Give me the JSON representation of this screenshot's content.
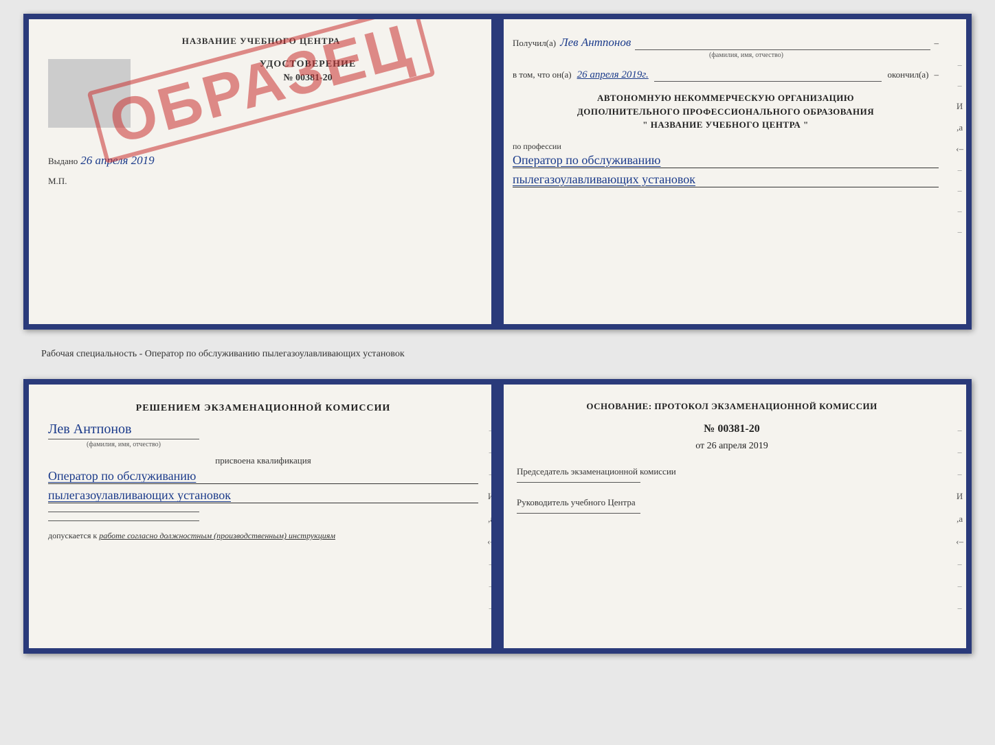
{
  "top_spread": {
    "left_page": {
      "title": "НАЗВАНИЕ УЧЕБНОГО ЦЕНТРА",
      "cert_type": "УДОСТОВЕРЕНИЕ",
      "cert_number": "№ 00381-20",
      "issued_label": "Выдано",
      "issued_date": "26 апреля 2019",
      "mp_label": "М.П.",
      "watermark": "ОБРАЗЕЦ"
    },
    "right_page": {
      "recipient_label": "Получил(а)",
      "recipient_name": "Лев Антпонов",
      "fio_sublabel": "(фамилия, имя, отчество)",
      "in_that_label": "в том, что он(а)",
      "date_value": "26 апреля 2019г.",
      "finished_label": "окончил(а)",
      "org_line1": "АВТОНОМНУЮ НЕКОММЕРЧЕСКУЮ ОРГАНИЗАЦИЮ",
      "org_line2": "ДОПОЛНИТЕЛЬНОГО ПРОФЕССИОНАЛЬНОГО ОБРАЗОВАНИЯ",
      "org_line3": "\" НАЗВАНИЕ УЧЕБНОГО ЦЕНТРА \"",
      "profession_label": "по профессии",
      "profession_line1": "Оператор по обслуживанию",
      "profession_line2": "пылегазоулавливающих установок"
    }
  },
  "middle_text": "Рабочая специальность - Оператор по обслуживанию пылегазоулавливающих установок",
  "bottom_spread": {
    "left_page": {
      "decision_title": "Решением экзаменационной комиссии",
      "name": "Лев Антпонов",
      "fio_sublabel": "(фамилия, имя, отчество)",
      "assigned_label": "присвоена квалификация",
      "qualification_line1": "Оператор по обслуживанию",
      "qualification_line2": "пылегазоулавливающих установок",
      "allowed_label": "допускается к",
      "allowed_value": "работе согласно должностным (производственным) инструкциям"
    },
    "right_page": {
      "basis_label": "Основание: протокол экзаменационной комиссии",
      "protocol_number": "№ 00381-20",
      "date_prefix": "от",
      "date_value": "26 апреля 2019",
      "chairman_label": "Председатель экзаменационной комиссии",
      "director_label": "Руководитель учебного Центра"
    }
  }
}
